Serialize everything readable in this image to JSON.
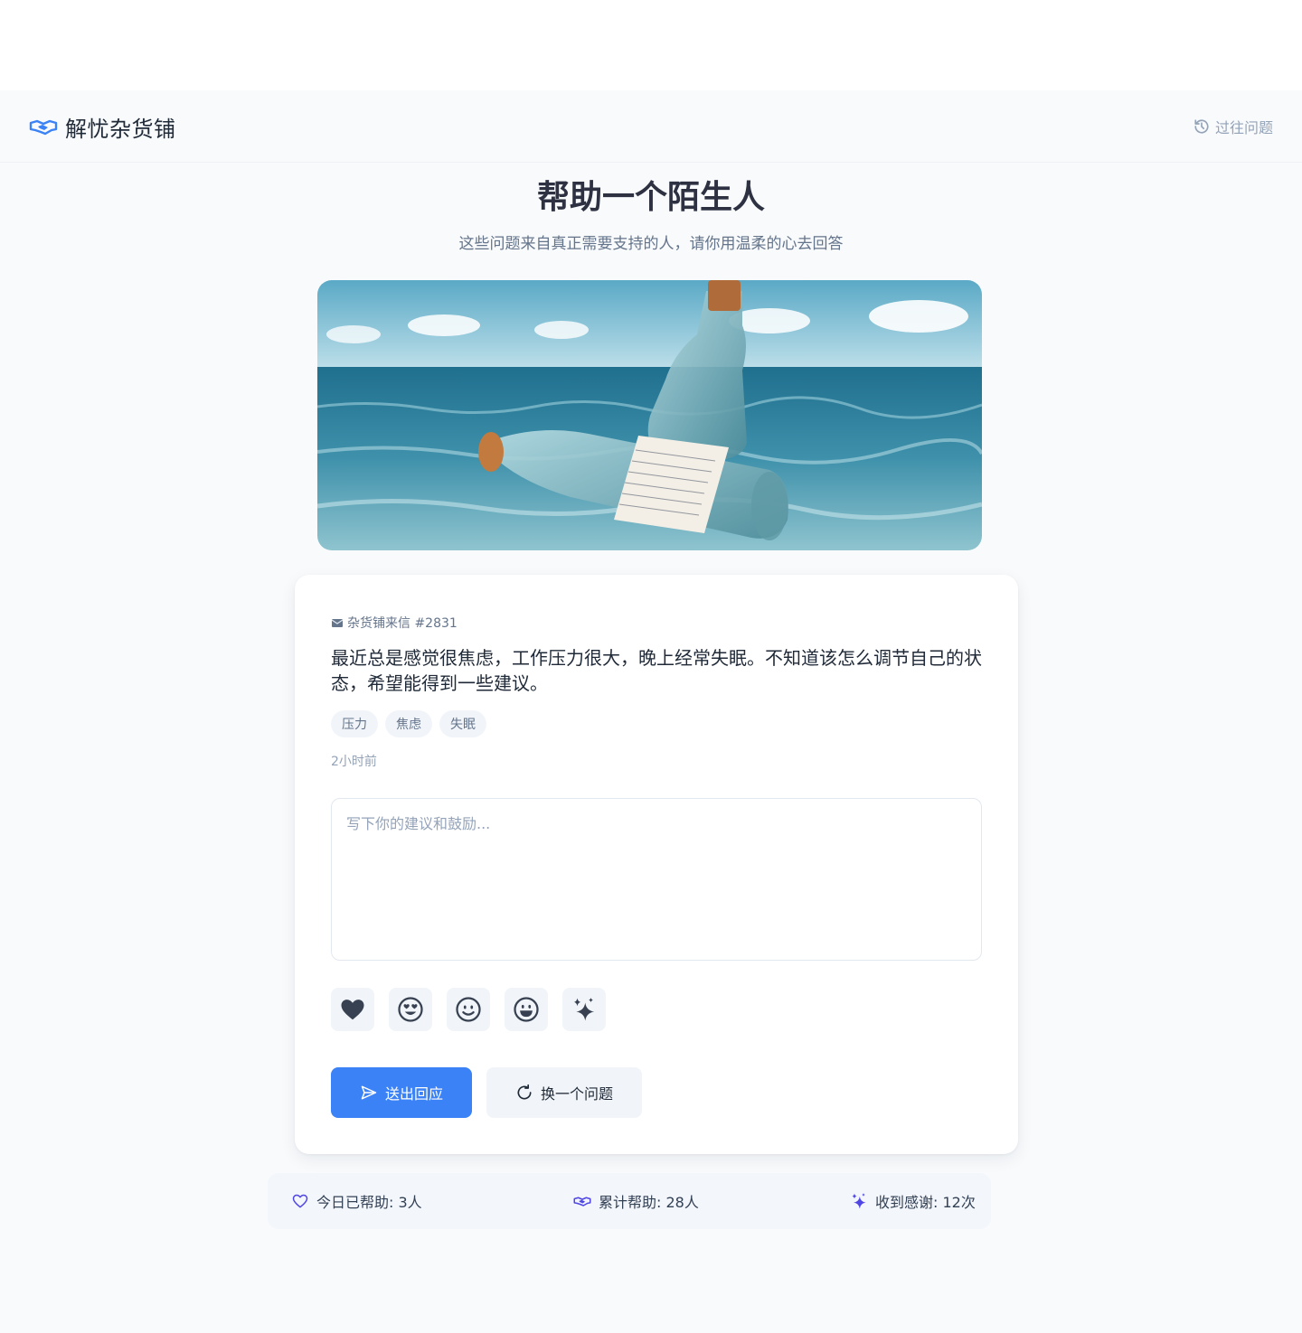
{
  "header": {
    "app_name": "解忧杂货铺",
    "logo_icon": "handshake-icon",
    "history_label": "过往问题",
    "history_icon": "history-icon"
  },
  "page": {
    "title": "帮助一个陌生人",
    "subtitle": "这些问题来自真正需要支持的人，请你用温柔的心去回答"
  },
  "hero": {
    "image": "message-in-a-bottle-on-sea"
  },
  "letter": {
    "meta_icon": "letter-icon",
    "meta_label": "杂货铺来信 #2831",
    "question": "最近总是感觉很焦虑，工作压力很大，晚上经常失眠。不知道该怎么调节自己的状态，希望能得到一些建议。",
    "tags": [
      "压力",
      "焦虑",
      "失眠"
    ],
    "time": "2小时前"
  },
  "reply": {
    "placeholder": "写下你的建议和鼓励...",
    "value": ""
  },
  "emojis": [
    "heart-icon",
    "heart-eyes-icon",
    "smile-icon",
    "grin-icon",
    "sparkles-icon"
  ],
  "actions": {
    "send_label": "送出回应",
    "switch_label": "换一个问题"
  },
  "stats": {
    "today_label": "今日已帮助: 3人",
    "total_label": "累计帮助: 28人",
    "thanks_label": "收到感谢: 12次"
  },
  "colors": {
    "accent": "#3b82f6",
    "stat_icon": "#4f46e5",
    "background": "#f8fafc"
  }
}
